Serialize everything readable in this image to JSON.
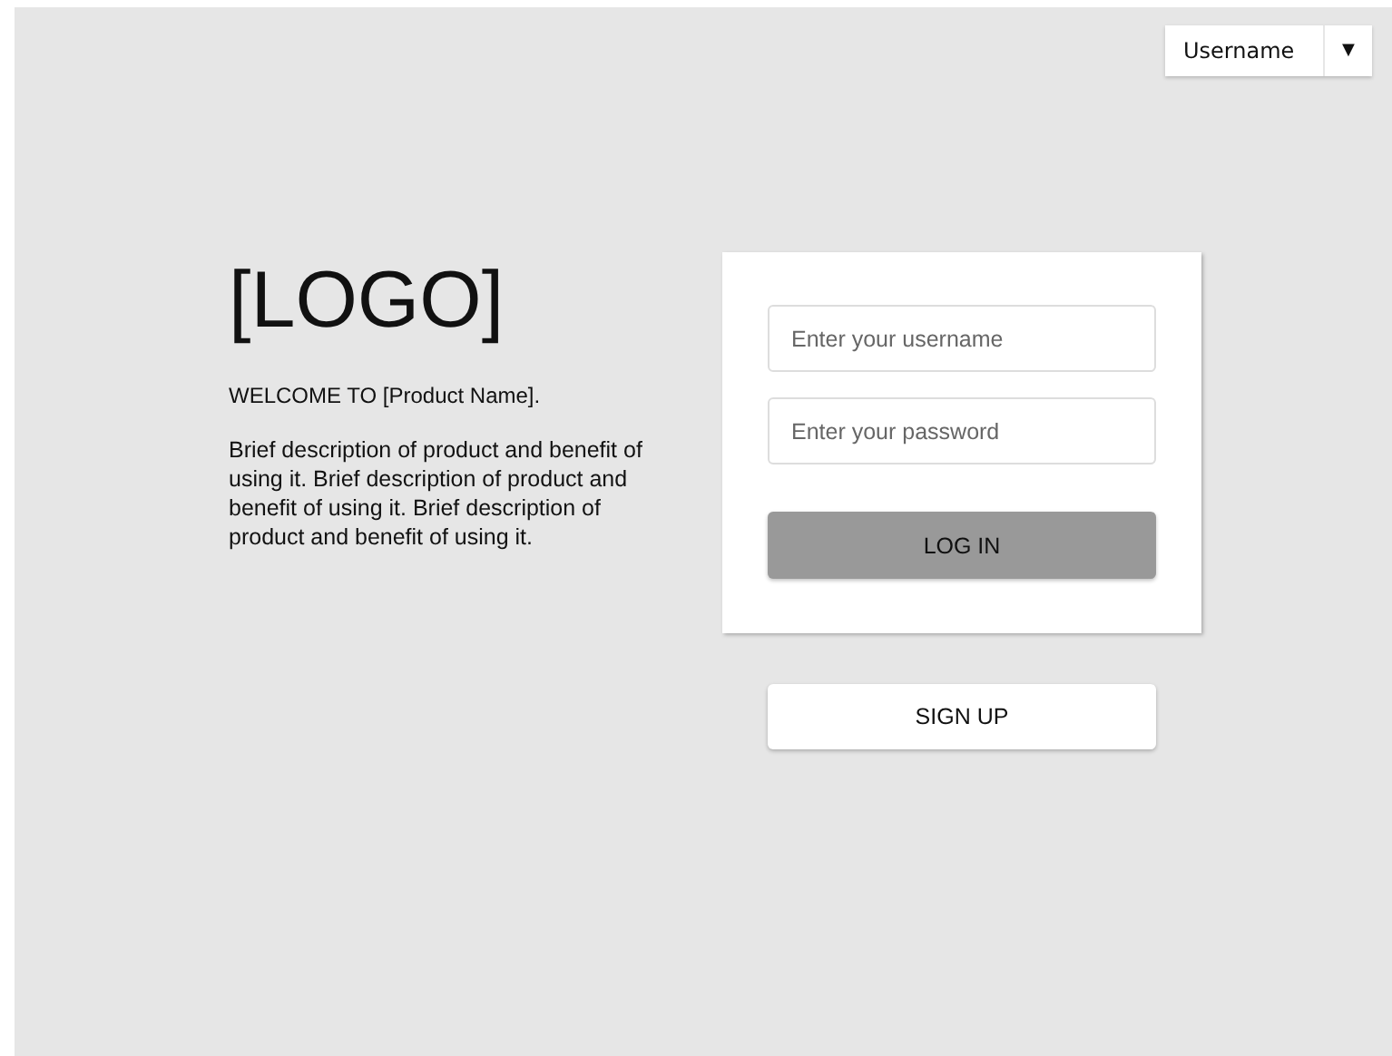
{
  "user_menu": {
    "label": "Username",
    "caret": "▼"
  },
  "logo": "[LOGO]",
  "welcome": "WELCOME TO [Product Name].",
  "description": "Brief description of product and benefit of using it. Brief description of product and benefit of using it. Brief description of product and benefit of using it.",
  "login_form": {
    "username": {
      "placeholder": "Enter your username"
    },
    "password": {
      "placeholder": "Enter your password"
    },
    "login_button": "LOG IN"
  },
  "signup_button": "SIGN UP"
}
